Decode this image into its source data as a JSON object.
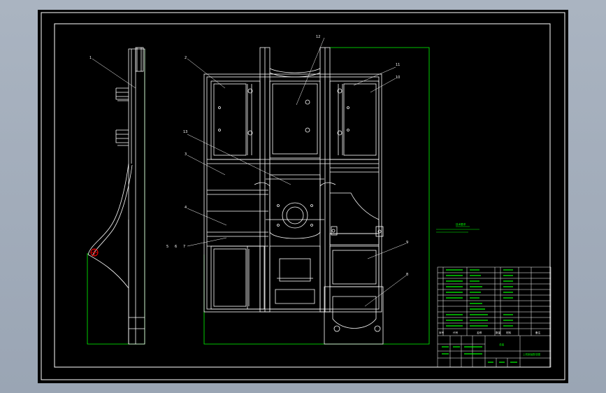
{
  "colors": {
    "background": "#000000",
    "outside": "#9aa5b4",
    "line_white": "#ffffff",
    "line_green": "#00ff00",
    "marker_red": "#ff0000"
  },
  "part_labels": [
    "1",
    "2",
    "3",
    "4",
    "5",
    "6",
    "7",
    "8",
    "9",
    "10",
    "11",
    "12",
    "13"
  ],
  "notes": {
    "technical_requirements": "技术要求"
  },
  "title_block": {
    "drawing_title": "总装",
    "drawing_name": "上机架装配总图",
    "header": [
      "序号",
      "代号",
      "名称",
      "数量",
      "材料",
      "备注"
    ]
  }
}
